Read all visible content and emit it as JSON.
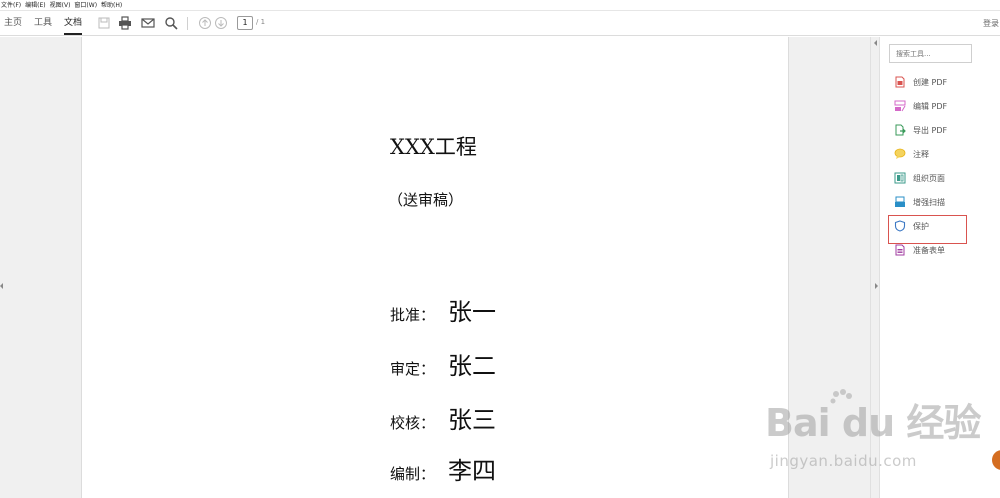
{
  "menubar": {
    "items": [
      "文件(F)",
      "编辑(E)",
      "视图(V)",
      "窗口(W)",
      "帮助(H)"
    ]
  },
  "toolbar": {
    "tabs": [
      "主页",
      "工具",
      "文档"
    ],
    "active_tab": "文档",
    "page_current": "1",
    "page_total": "/ 1",
    "login": "登录"
  },
  "document": {
    "title": "XXX工程",
    "subtitle": "（送审稿）",
    "signatures": [
      {
        "label": "批准：",
        "name": "张一"
      },
      {
        "label": "审定：",
        "name": "张二"
      },
      {
        "label": "校核：",
        "name": "张三"
      },
      {
        "label": "编制：",
        "name": "李四"
      }
    ]
  },
  "tools_panel": {
    "search_placeholder": "搜索工具...",
    "items": [
      {
        "label": "创建 PDF",
        "icon": "create-pdf-icon",
        "color": "#d9534f"
      },
      {
        "label": "编辑 PDF",
        "icon": "edit-pdf-icon",
        "color": "#d468c8"
      },
      {
        "label": "导出 PDF",
        "icon": "export-pdf-icon",
        "color": "#3a9a5a"
      },
      {
        "label": "注释",
        "icon": "comment-icon",
        "color": "#e8b418"
      },
      {
        "label": "组织页面",
        "icon": "organize-pages-icon",
        "color": "#3a9a8a"
      },
      {
        "label": "增强扫描",
        "icon": "enhance-scan-icon",
        "color": "#2a8fc7"
      },
      {
        "label": "保护",
        "icon": "shield-icon",
        "color": "#3b78c4"
      },
      {
        "label": "准备表单",
        "icon": "prepare-form-icon",
        "color": "#a03ca0"
      }
    ],
    "highlighted": "保护"
  },
  "watermark": {
    "logo": "Bai du 经验",
    "url": "jingyan.baidu.com"
  }
}
